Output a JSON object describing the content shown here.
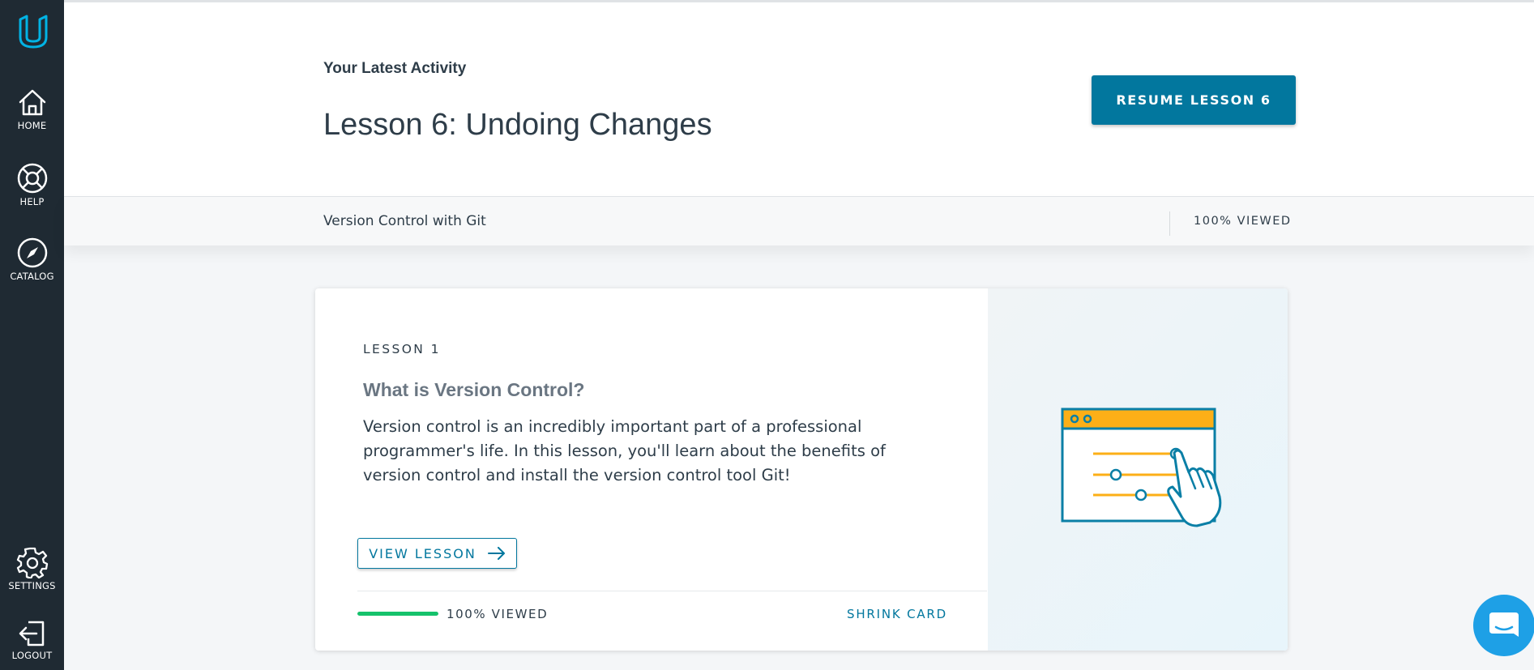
{
  "sidebar": {
    "items": [
      {
        "label": "HOME",
        "icon": "home-icon"
      },
      {
        "label": "HELP",
        "icon": "lifebuoy-icon"
      },
      {
        "label": "CATALOG",
        "icon": "compass-icon"
      },
      {
        "label": "SETTINGS",
        "icon": "gear-icon"
      },
      {
        "label": "LOGOUT",
        "icon": "logout-icon"
      }
    ]
  },
  "header": {
    "latest_label": "Your Latest Activity",
    "lesson_title": "Lesson 6: Undoing Changes",
    "resume_button": "RESUME LESSON 6"
  },
  "subheader": {
    "course_name": "Version Control with Git",
    "viewed": "100% VIEWED"
  },
  "card": {
    "lesson_number": "LESSON 1",
    "title": "What is Version Control?",
    "description": "Version control is an incredibly important part of a professional programmer's life. In this lesson, you'll learn about the benefits of version control and install the version control tool Git!",
    "view_button": "VIEW LESSON",
    "progress_fraction": 1.0,
    "viewed": "100% VIEWED",
    "shrink": "SHRINK CARD"
  },
  "colors": {
    "sidebar": "#1f2a33",
    "accent": "#02779e",
    "logo": "#02b3e4",
    "progress": "#15c26b",
    "illustration_orange": "#fcaf17",
    "chat": "#1ea0e6"
  }
}
